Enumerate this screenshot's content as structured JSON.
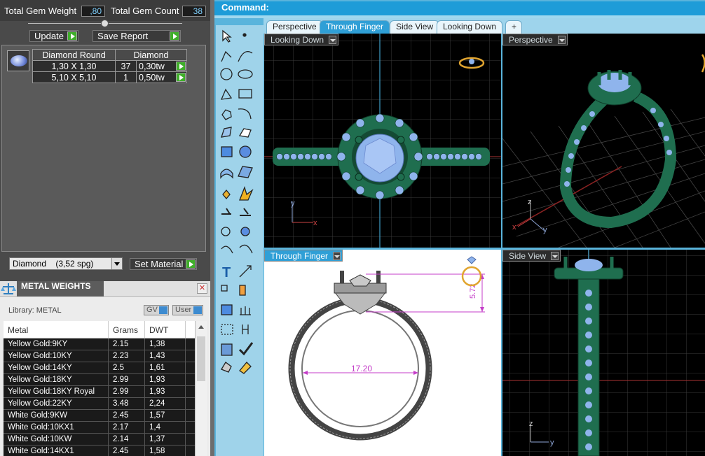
{
  "gems": {
    "total_weight_label": "Total Gem Weight",
    "total_weight_value": ",80",
    "total_count_label": "Total Gem Count",
    "total_count_value": "38",
    "update_label": "Update",
    "save_report_label": "Save Report",
    "table": {
      "headers": [
        "Diamond Round",
        "Diamond"
      ],
      "rows": [
        {
          "size": "1,30 X 1,30",
          "count": "37",
          "weight": "0,30tw"
        },
        {
          "size": "5,10 X 5,10",
          "count": "1",
          "weight": "0,50tw"
        }
      ]
    },
    "material_select": "Diamond    (3,52 spg)",
    "set_material_label": "Set Material"
  },
  "metal_weights": {
    "title": "METAL WEIGHTS",
    "library_label": "Library: METAL",
    "gv_label": "GV",
    "user_label": "User",
    "columns": [
      "Metal",
      "Grams",
      "DWT"
    ],
    "rows": [
      {
        "metal": "Yellow Gold:9KY",
        "grams": "2.15",
        "dwt": "1,38"
      },
      {
        "metal": "Yellow Gold:10KY",
        "grams": "2.23",
        "dwt": "1,43"
      },
      {
        "metal": "Yellow Gold:14KY",
        "grams": "2.5",
        "dwt": "1,61"
      },
      {
        "metal": "Yellow Gold:18KY",
        "grams": "2.99",
        "dwt": "1,93"
      },
      {
        "metal": "Yellow Gold:18KY Royal",
        "grams": "2.99",
        "dwt": "1,93"
      },
      {
        "metal": "Yellow Gold:22KY",
        "grams": "3.48",
        "dwt": "2,24"
      },
      {
        "metal": "White Gold:9KW",
        "grams": "2.45",
        "dwt": "1,57"
      },
      {
        "metal": "White Gold:10KX1",
        "grams": "2.17",
        "dwt": "1,4"
      },
      {
        "metal": "White Gold:10KW",
        "grams": "2.14",
        "dwt": "1,37"
      },
      {
        "metal": "White Gold:14KX1",
        "grams": "2.45",
        "dwt": "1,58"
      }
    ]
  },
  "command": {
    "label": "Command:"
  },
  "tabs": [
    {
      "label": "Perspective",
      "active": false
    },
    {
      "label": "Through Finger",
      "active": true
    },
    {
      "label": "Side View",
      "active": false
    },
    {
      "label": "Looking Down",
      "active": false
    },
    {
      "label": "+",
      "active": false
    }
  ],
  "viewports": {
    "top_left": "Looking Down",
    "top_right": "Perspective",
    "bottom_left": "Through Finger",
    "bottom_right": "Side View"
  },
  "dimensions": {
    "height": "5.72",
    "width": "17.20"
  },
  "axes": {
    "x": "x",
    "y": "y",
    "z": "z"
  },
  "colors": {
    "metal": "#1f6e4f",
    "gem": "#8fb4ec",
    "grid": "#3a3a3a",
    "accent": "#1e9cd8",
    "dimension": "#c43dc8"
  }
}
